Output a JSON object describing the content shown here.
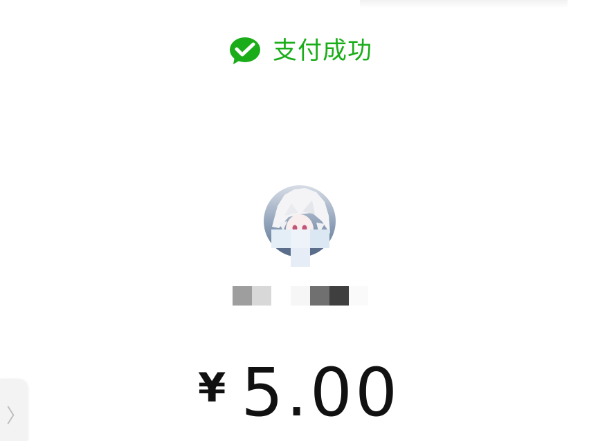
{
  "status": {
    "icon": "wechat-pay-check-icon",
    "text": "支付成功",
    "color": "#1aad19"
  },
  "payee": {
    "avatar": "anime-character-avatar",
    "name_obscured": true
  },
  "payment": {
    "currency_symbol": "¥",
    "amount": "5.00"
  },
  "side_handle": {
    "icon": "chevron-right-icon",
    "glyph": "〉"
  }
}
